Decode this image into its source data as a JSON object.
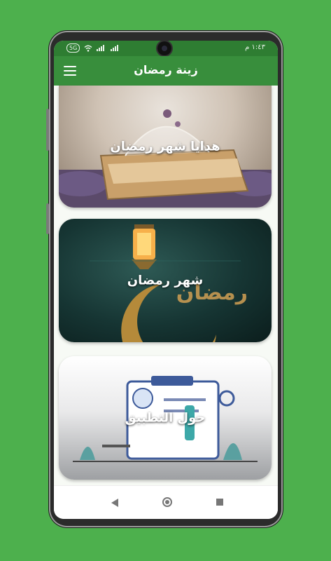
{
  "status_bar": {
    "badge": "5G",
    "time": "١:٤٣ م",
    "wifi_icon": "wifi-icon",
    "signal_icon": "signal-icon"
  },
  "app_bar": {
    "title": "زينة رمضان",
    "menu_icon": "hamburger-menu-icon"
  },
  "cards": [
    {
      "label": "هدايا شهر رمضان"
    },
    {
      "label": "شهر رمضان",
      "image_text": "رمضان"
    },
    {
      "label": "حول التطبيق"
    }
  ],
  "colors": {
    "background": "#4db04d",
    "status_bar": "#2e7d32",
    "app_bar": "#388e3c"
  },
  "nav_bar": {
    "back_icon": "back-triangle-icon",
    "home_icon": "home-circle-icon",
    "recents_icon": "recents-square-icon"
  }
}
